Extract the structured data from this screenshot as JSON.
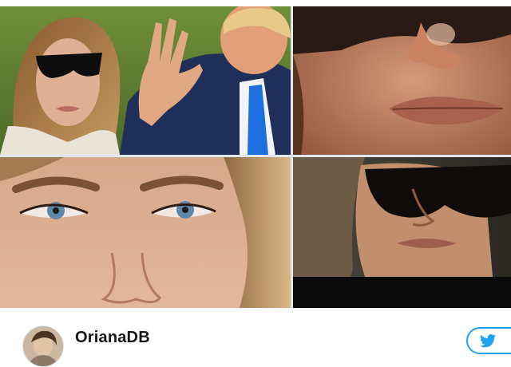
{
  "tweet": {
    "username": "OrianaDB"
  },
  "images": [
    {
      "id": "melania-sunglasses-with-trump"
    },
    {
      "id": "closeup-nose-lips"
    },
    {
      "id": "closeup-blue-eyes"
    },
    {
      "id": "closeup-sunglasses-profile"
    }
  ],
  "icons": {
    "avatar": "avatar-photo",
    "follow": "twitter-bird-icon"
  },
  "colors": {
    "twitter_blue": "#1da1f2",
    "divider": "#dfe6ee"
  }
}
